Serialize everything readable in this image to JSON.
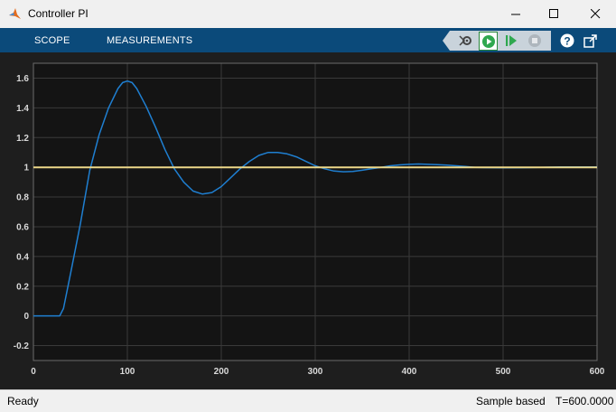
{
  "window": {
    "title": "Controller PI",
    "minimize_icon": "minimize-icon",
    "maximize_icon": "maximize-icon",
    "close_icon": "close-icon"
  },
  "toolstrip": {
    "tabs": [
      "SCOPE",
      "MEASUREMENTS"
    ],
    "buttons": [
      "settings-icon",
      "run-icon",
      "step-forward-icon",
      "stop-icon",
      "help-icon",
      "undock-icon"
    ]
  },
  "colors": {
    "axes_bg": "#141414",
    "grid": "#3a3a3a",
    "signal_1": "#1f7fd1",
    "signal_2": "#edd88a",
    "tick_label": "#d9d9d9"
  },
  "chart_data": {
    "type": "line",
    "xlim": [
      0,
      600
    ],
    "ylim": [
      -0.3,
      1.7
    ],
    "xticks": [
      0,
      100,
      200,
      300,
      400,
      500,
      600
    ],
    "yticks": [
      -0.2,
      0,
      0.2,
      0.4,
      0.6,
      0.8,
      1,
      1.2,
      1.4,
      1.6
    ],
    "ytick_labels": [
      "-0.2",
      "0",
      "0.2",
      "0.4",
      "0.6",
      "0.8",
      "1",
      "1.2",
      "1.4",
      "1.6"
    ],
    "grid": true,
    "series": [
      {
        "x": [
          0,
          28,
          32,
          40,
          50,
          60,
          70,
          80,
          90,
          95,
          100,
          105,
          110,
          120,
          130,
          140,
          150,
          160,
          170,
          180,
          190,
          200,
          210,
          220,
          230,
          240,
          250,
          260,
          270,
          280,
          290,
          300,
          310,
          320,
          330,
          340,
          350,
          360,
          370,
          380,
          390,
          400,
          410,
          420,
          430,
          440,
          450,
          460,
          470,
          480,
          500,
          520,
          540,
          560,
          580,
          600
        ],
        "y": [
          0,
          0,
          0.05,
          0.3,
          0.62,
          0.98,
          1.22,
          1.4,
          1.53,
          1.57,
          1.58,
          1.57,
          1.53,
          1.41,
          1.27,
          1.12,
          0.99,
          0.9,
          0.84,
          0.82,
          0.83,
          0.87,
          0.93,
          0.99,
          1.04,
          1.08,
          1.1,
          1.1,
          1.09,
          1.07,
          1.04,
          1.01,
          0.99,
          0.975,
          0.97,
          0.972,
          0.98,
          0.99,
          1.0,
          1.01,
          1.016,
          1.02,
          1.022,
          1.02,
          1.018,
          1.014,
          1.01,
          1.005,
          1.0,
          0.998,
          0.996,
          0.997,
          1.0,
          1.002,
          1.003,
          1.002
        ]
      },
      {
        "x": [
          0,
          600
        ],
        "y": [
          1,
          1
        ]
      }
    ]
  },
  "status": {
    "left": "Ready",
    "sample": "Sample based",
    "time": "T=600.0000"
  }
}
